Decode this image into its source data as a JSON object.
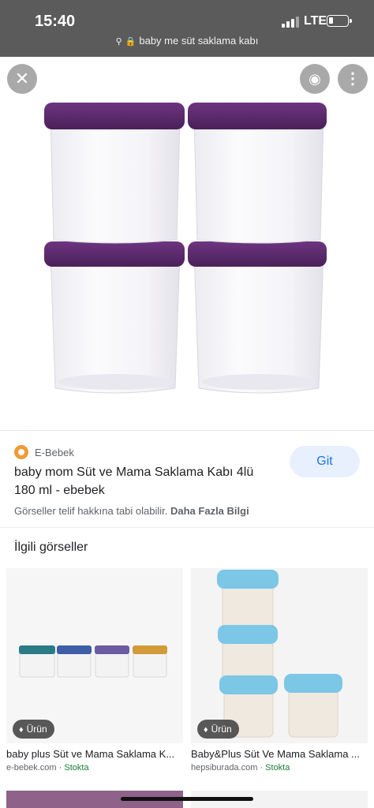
{
  "status_bar": {
    "time": "15:40",
    "network": "LTE"
  },
  "url_bar": {
    "text": "baby me süt saklama kabı"
  },
  "viewer": {
    "close_icon": "close-icon",
    "lens_icon": "lens-icon",
    "more_icon": "more-vert-icon",
    "lid_color": "#5b2a6b"
  },
  "result": {
    "source": "E-Bebek",
    "title": "baby mom Süt ve Mama Saklama Kabı 4lü 180 ml - ebebek",
    "visit_button": "Git",
    "copyright_text": "Görseller telif hakkına tabi olabilir.",
    "more_info": "Daha Fazla Bilgi"
  },
  "related": {
    "heading": "İlgili görseller",
    "items": [
      {
        "badge": "Ürün",
        "title": "baby plus Süt ve Mama Saklama K...",
        "site": "e-bebek.com",
        "stock": "Stokta"
      },
      {
        "badge": "Ürün",
        "title": "Baby&Plus Süt Ve Mama Saklama ...",
        "site": "hepsiburada.com",
        "stock": "Stokta"
      }
    ]
  }
}
